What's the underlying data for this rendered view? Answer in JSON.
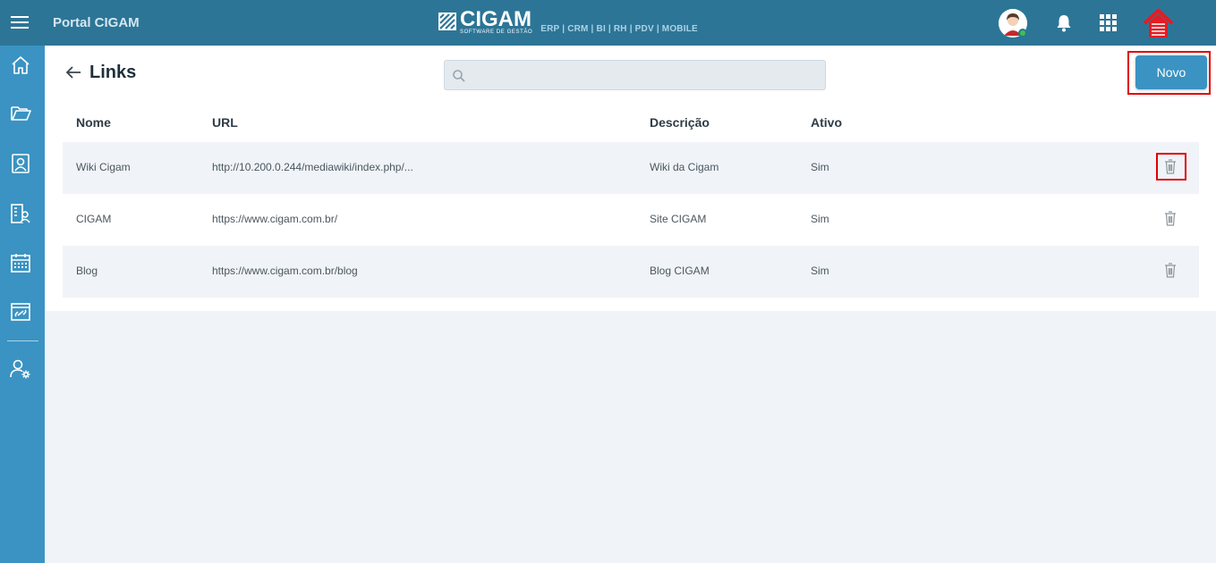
{
  "header": {
    "app_title": "Portal CIGAM",
    "logo_word": "CIGAM",
    "logo_sub": "SOFTWARE DE GESTÃO",
    "products": "ERP | CRM | BI | RH | PDV | MOBILE"
  },
  "page": {
    "title": "Links",
    "search_placeholder": "",
    "new_button": "Novo"
  },
  "table": {
    "columns": [
      "Nome",
      "URL",
      "Descrição",
      "Ativo"
    ],
    "rows": [
      {
        "nome": "Wiki Cigam",
        "url": "http://10.200.0.244/mediawiki/index.php/...",
        "descricao": "Wiki da Cigam",
        "ativo": "Sim"
      },
      {
        "nome": "CIGAM",
        "url": "https://www.cigam.com.br/",
        "descricao": "Site CIGAM",
        "ativo": "Sim"
      },
      {
        "nome": "Blog",
        "url": "https://www.cigam.com.br/blog",
        "descricao": "Blog CIGAM",
        "ativo": "Sim"
      }
    ]
  },
  "colors": {
    "topbar": "#2d7596",
    "sidebar": "#3a93c2",
    "accent": "#3a93c2",
    "highlight": "#e00000"
  }
}
